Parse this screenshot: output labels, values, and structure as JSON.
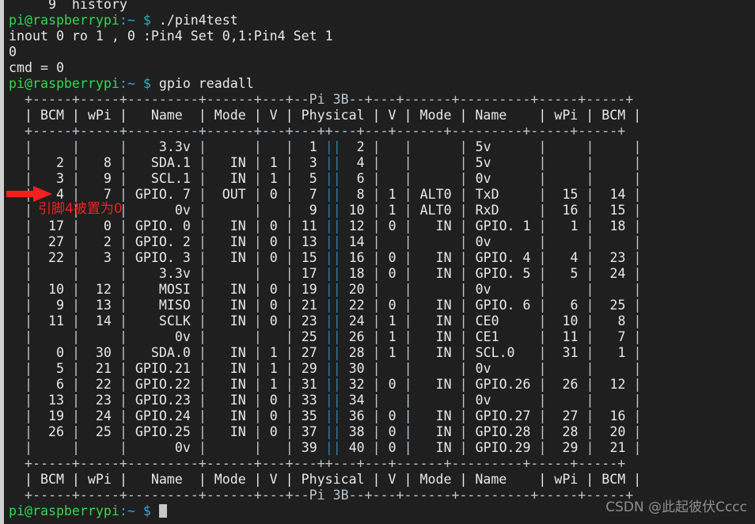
{
  "terminal": {
    "title": "pi@raspberrypi: ~",
    "host_prompt": "pi@raspberrypi",
    "prompt_path": ":~",
    "prompt_sigil": "$",
    "background_color": "#1f1f1f",
    "foreground_color": "#e8e8e8",
    "prompt_color": "#30d94e",
    "path_color": "#3b9fd6",
    "sigil_color": "#1fb2d4",
    "separator_color": "#2a7fa8",
    "annotation_color": "#f32020",
    "watermark_color": "#8f8f8f"
  },
  "history": {
    "entry_number": "9",
    "entry_command": "history"
  },
  "commands": {
    "first": "./pin4test",
    "second": "gpio readall"
  },
  "program_output": [
    "inout 0 ro 1 , 0 :Pin4 Set 0,1:Pin4 Set 1",
    "0",
    "cmd = 0"
  ],
  "annotations": {
    "arrow_label": "red-arrow-pointing-to-bcm-4",
    "text": "引脚4被置为0"
  },
  "watermark": {
    "text": "CSDN @此起彼伏Cccc"
  },
  "gpio_table": {
    "board_label": "Pi 3B",
    "headers": [
      "BCM",
      "wPi",
      "Name",
      "Mode",
      "V",
      "Physical",
      "V",
      "Mode",
      "Name",
      "wPi",
      "BCM"
    ],
    "border_top": "  +-----+-----+---------+------+---+---Pi 3B--+---+------+---------+-----+-----+",
    "border_mid": "  +-----+-----+---------+------+---+---++---+------+---------+-----+-----+",
    "header_line": "  | BCM | wPi |   Name  | Mode | V | Physical | V | Mode | Name    | wPi | BCM |",
    "border_bottom": "  +-----+-----+---------+------+---+---Pi 3B--+---+------+---------+-----+-----+",
    "rows": [
      {
        "bcm": "",
        "wpi": "",
        "name": "3.3v",
        "mode": "",
        "v": "",
        "phys_l": "1",
        "phys_r": "2",
        "v2": "",
        "mode2": "",
        "name2": "5v",
        "wpi2": "",
        "bcm2": ""
      },
      {
        "bcm": "2",
        "wpi": "8",
        "name": "SDA.1",
        "mode": "IN",
        "v": "1",
        "phys_l": "3",
        "phys_r": "4",
        "v2": "",
        "mode2": "",
        "name2": "5v",
        "wpi2": "",
        "bcm2": ""
      },
      {
        "bcm": "3",
        "wpi": "9",
        "name": "SCL.1",
        "mode": "IN",
        "v": "1",
        "phys_l": "5",
        "phys_r": "6",
        "v2": "",
        "mode2": "",
        "name2": "0v",
        "wpi2": "",
        "bcm2": ""
      },
      {
        "bcm": "4",
        "wpi": "7",
        "name": "GPIO. 7",
        "mode": "OUT",
        "v": "0",
        "phys_l": "7",
        "phys_r": "8",
        "v2": "1",
        "mode2": "ALT0",
        "name2": "TxD",
        "wpi2": "15",
        "bcm2": "14"
      },
      {
        "bcm": "",
        "wpi": "",
        "name": "0v",
        "mode": "",
        "v": "",
        "phys_l": "9",
        "phys_r": "10",
        "v2": "1",
        "mode2": "ALT0",
        "name2": "RxD",
        "wpi2": "16",
        "bcm2": "15"
      },
      {
        "bcm": "17",
        "wpi": "0",
        "name": "GPIO. 0",
        "mode": "IN",
        "v": "0",
        "phys_l": "11",
        "phys_r": "12",
        "v2": "0",
        "mode2": "IN",
        "name2": "GPIO. 1",
        "wpi2": "1",
        "bcm2": "18"
      },
      {
        "bcm": "27",
        "wpi": "2",
        "name": "GPIO. 2",
        "mode": "IN",
        "v": "0",
        "phys_l": "13",
        "phys_r": "14",
        "v2": "",
        "mode2": "",
        "name2": "0v",
        "wpi2": "",
        "bcm2": ""
      },
      {
        "bcm": "22",
        "wpi": "3",
        "name": "GPIO. 3",
        "mode": "IN",
        "v": "0",
        "phys_l": "15",
        "phys_r": "16",
        "v2": "0",
        "mode2": "IN",
        "name2": "GPIO. 4",
        "wpi2": "4",
        "bcm2": "23"
      },
      {
        "bcm": "",
        "wpi": "",
        "name": "3.3v",
        "mode": "",
        "v": "",
        "phys_l": "17",
        "phys_r": "18",
        "v2": "0",
        "mode2": "IN",
        "name2": "GPIO. 5",
        "wpi2": "5",
        "bcm2": "24"
      },
      {
        "bcm": "10",
        "wpi": "12",
        "name": "MOSI",
        "mode": "IN",
        "v": "0",
        "phys_l": "19",
        "phys_r": "20",
        "v2": "",
        "mode2": "",
        "name2": "0v",
        "wpi2": "",
        "bcm2": ""
      },
      {
        "bcm": "9",
        "wpi": "13",
        "name": "MISO",
        "mode": "IN",
        "v": "0",
        "phys_l": "21",
        "phys_r": "22",
        "v2": "0",
        "mode2": "IN",
        "name2": "GPIO. 6",
        "wpi2": "6",
        "bcm2": "25"
      },
      {
        "bcm": "11",
        "wpi": "14",
        "name": "SCLK",
        "mode": "IN",
        "v": "0",
        "phys_l": "23",
        "phys_r": "24",
        "v2": "1",
        "mode2": "IN",
        "name2": "CE0",
        "wpi2": "10",
        "bcm2": "8"
      },
      {
        "bcm": "",
        "wpi": "",
        "name": "0v",
        "mode": "",
        "v": "",
        "phys_l": "25",
        "phys_r": "26",
        "v2": "1",
        "mode2": "IN",
        "name2": "CE1",
        "wpi2": "11",
        "bcm2": "7"
      },
      {
        "bcm": "0",
        "wpi": "30",
        "name": "SDA.0",
        "mode": "IN",
        "v": "1",
        "phys_l": "27",
        "phys_r": "28",
        "v2": "1",
        "mode2": "IN",
        "name2": "SCL.0",
        "wpi2": "31",
        "bcm2": "1"
      },
      {
        "bcm": "5",
        "wpi": "21",
        "name": "GPIO.21",
        "mode": "IN",
        "v": "1",
        "phys_l": "29",
        "phys_r": "30",
        "v2": "",
        "mode2": "",
        "name2": "0v",
        "wpi2": "",
        "bcm2": ""
      },
      {
        "bcm": "6",
        "wpi": "22",
        "name": "GPIO.22",
        "mode": "IN",
        "v": "1",
        "phys_l": "31",
        "phys_r": "32",
        "v2": "0",
        "mode2": "IN",
        "name2": "GPIO.26",
        "wpi2": "26",
        "bcm2": "12"
      },
      {
        "bcm": "13",
        "wpi": "23",
        "name": "GPIO.23",
        "mode": "IN",
        "v": "0",
        "phys_l": "33",
        "phys_r": "34",
        "v2": "",
        "mode2": "",
        "name2": "0v",
        "wpi2": "",
        "bcm2": ""
      },
      {
        "bcm": "19",
        "wpi": "24",
        "name": "GPIO.24",
        "mode": "IN",
        "v": "0",
        "phys_l": "35",
        "phys_r": "36",
        "v2": "0",
        "mode2": "IN",
        "name2": "GPIO.27",
        "wpi2": "27",
        "bcm2": "16"
      },
      {
        "bcm": "26",
        "wpi": "25",
        "name": "GPIO.25",
        "mode": "IN",
        "v": "0",
        "phys_l": "37",
        "phys_r": "38",
        "v2": "0",
        "mode2": "IN",
        "name2": "GPIO.28",
        "wpi2": "28",
        "bcm2": "20"
      },
      {
        "bcm": "",
        "wpi": "",
        "name": "0v",
        "mode": "",
        "v": "",
        "phys_l": "39",
        "phys_r": "40",
        "v2": "0",
        "mode2": "IN",
        "name2": "GPIO.29",
        "wpi2": "29",
        "bcm2": "21"
      }
    ]
  }
}
